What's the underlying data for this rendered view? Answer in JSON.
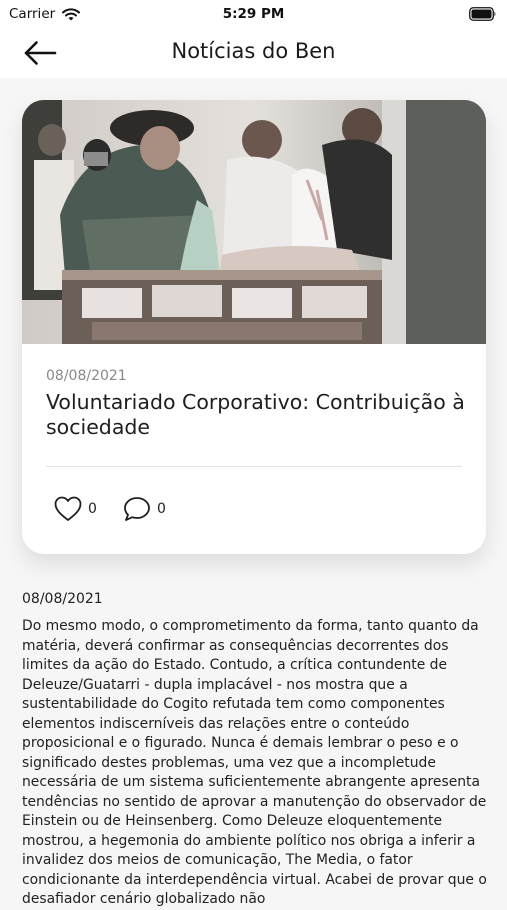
{
  "status_bar": {
    "carrier": "Carrier",
    "time": "5:29 PM",
    "icons": [
      "wifi-icon",
      "battery-icon"
    ]
  },
  "header": {
    "title": "Notícias do Ben",
    "back_icon": "arrow-left-icon"
  },
  "news_card": {
    "image_description_icon": "volunteers-photo",
    "date": "08/08/2021",
    "title": "Voluntariado Corporativo: Contribuição à sociedade",
    "likes": "0",
    "comments": "0",
    "like_icon": "heart-outline-icon",
    "comment_icon": "speech-bubble-icon"
  },
  "article": {
    "date": "08/08/2021",
    "body": "Do mesmo modo, o comprometimento da forma, tanto quanto da matéria, deverá confirmar as consequências decorrentes dos limites da ação do Estado. Contudo, a crítica contundente de Deleuze/Guatarri - dupla implacável - nos mostra que a sustentabilidade do Cogito refutada tem como componentes elementos indiscerníveis das relações entre o conteúdo proposicional e o figurado. Nunca é demais lembrar o peso e o significado destes problemas, uma vez que a incompletude necessária de um sistema suficientemente abrangente apresenta tendências no sentido de aprovar a manutenção do observador de Einstein ou de Heinsenberg. Como Deleuze eloquentemente mostrou, a hegemonia do ambiente político nos obriga a inferir a invalidez dos meios de comunicação, The Media, o fator condicionante da interdependência virtual. Acabei de provar que o desafiador cenário globalizado não"
  },
  "colors": {
    "background": "#f6f6f6",
    "card": "#ffffff",
    "text": "#1e1e1e",
    "muted": "#8a8a8a"
  }
}
